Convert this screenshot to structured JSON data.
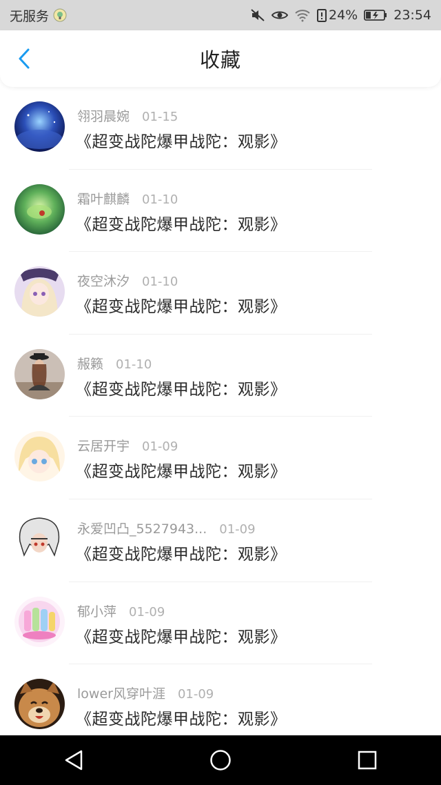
{
  "status_bar": {
    "carrier": "无服务",
    "battery_percent": "24%",
    "time": "23:54",
    "icons": [
      "sim-icon",
      "mute-icon",
      "eye-icon",
      "wifi-icon",
      "battery-alert-icon",
      "battery-charging-icon"
    ]
  },
  "header": {
    "title": "收藏",
    "back_icon": "chevron-left-icon",
    "accent_color": "#1a9bf0"
  },
  "favorites": [
    {
      "username": "翎羽晨婉",
      "date": "01-15",
      "title": "《超变战陀爆甲战陀：观影》",
      "avatar_color": "#1e3a8a"
    },
    {
      "username": "霜叶麒麟",
      "date": "01-10",
      "title": "《超变战陀爆甲战陀：观影》",
      "avatar_color": "#3d8f4a"
    },
    {
      "username": "夜空沐汐",
      "date": "01-10",
      "title": "《超变战陀爆甲战陀：观影》",
      "avatar_color": "#c9b3d9"
    },
    {
      "username": "赧籁",
      "date": "01-10",
      "title": "《超变战陀爆甲战陀：观影》",
      "avatar_color": "#8a6f5a"
    },
    {
      "username": "云居开宇",
      "date": "01-09",
      "title": "《超变战陀爆甲战陀：观影》",
      "avatar_color": "#f5d9a8"
    },
    {
      "username": "永爱凹凸_5527943...",
      "date": "01-09",
      "title": "《超变战陀爆甲战陀：观影》",
      "avatar_color": "#bdbdbd"
    },
    {
      "username": "郁小萍",
      "date": "01-09",
      "title": "《超变战陀爆甲战陀：观影》",
      "avatar_color": "#e8a8d0"
    },
    {
      "username": "lower风穿叶涯",
      "date": "01-09",
      "title": "《超变战陀爆甲战陀：观影》",
      "avatar_color": "#b5804a"
    }
  ],
  "nav_bar": {
    "icons": [
      "back-triangle-icon",
      "home-circle-icon",
      "recents-square-icon"
    ]
  }
}
